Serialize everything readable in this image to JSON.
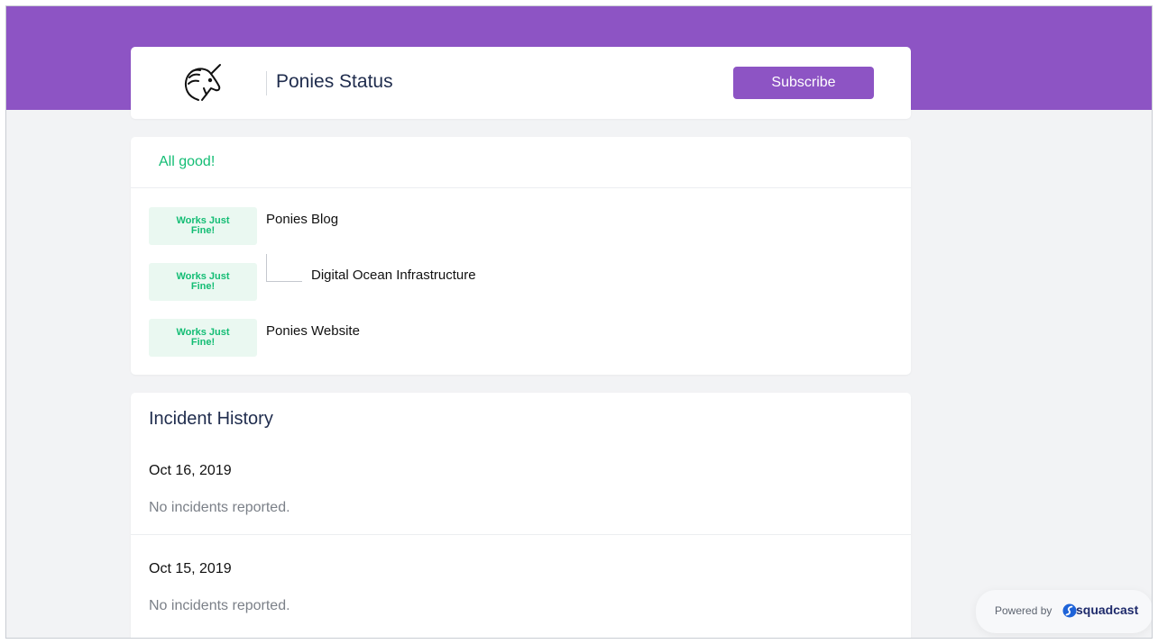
{
  "header": {
    "logo_icon": "unicorn-icon",
    "title": "Ponies Status",
    "subscribe_label": "Subscribe",
    "accent_color": "#8d54c4"
  },
  "status": {
    "overall": "All good!",
    "overall_color": "#13bd74",
    "components": [
      {
        "status": "Works Just Fine!",
        "name": "Ponies Blog"
      },
      {
        "status": "Works Just Fine!",
        "name": "Digital Ocean Infrastructure",
        "child": true
      },
      {
        "status": "Works Just Fine!",
        "name": "Ponies Website"
      }
    ]
  },
  "history": {
    "title": "Incident History",
    "days": [
      {
        "date": "Oct 16, 2019",
        "message": "No incidents reported."
      },
      {
        "date": "Oct 15, 2019",
        "message": "No incidents reported."
      }
    ]
  },
  "footer": {
    "powered_label": "Powered by",
    "brand_icon": "squadcast-logo-icon",
    "brand_name": "squadcast"
  }
}
